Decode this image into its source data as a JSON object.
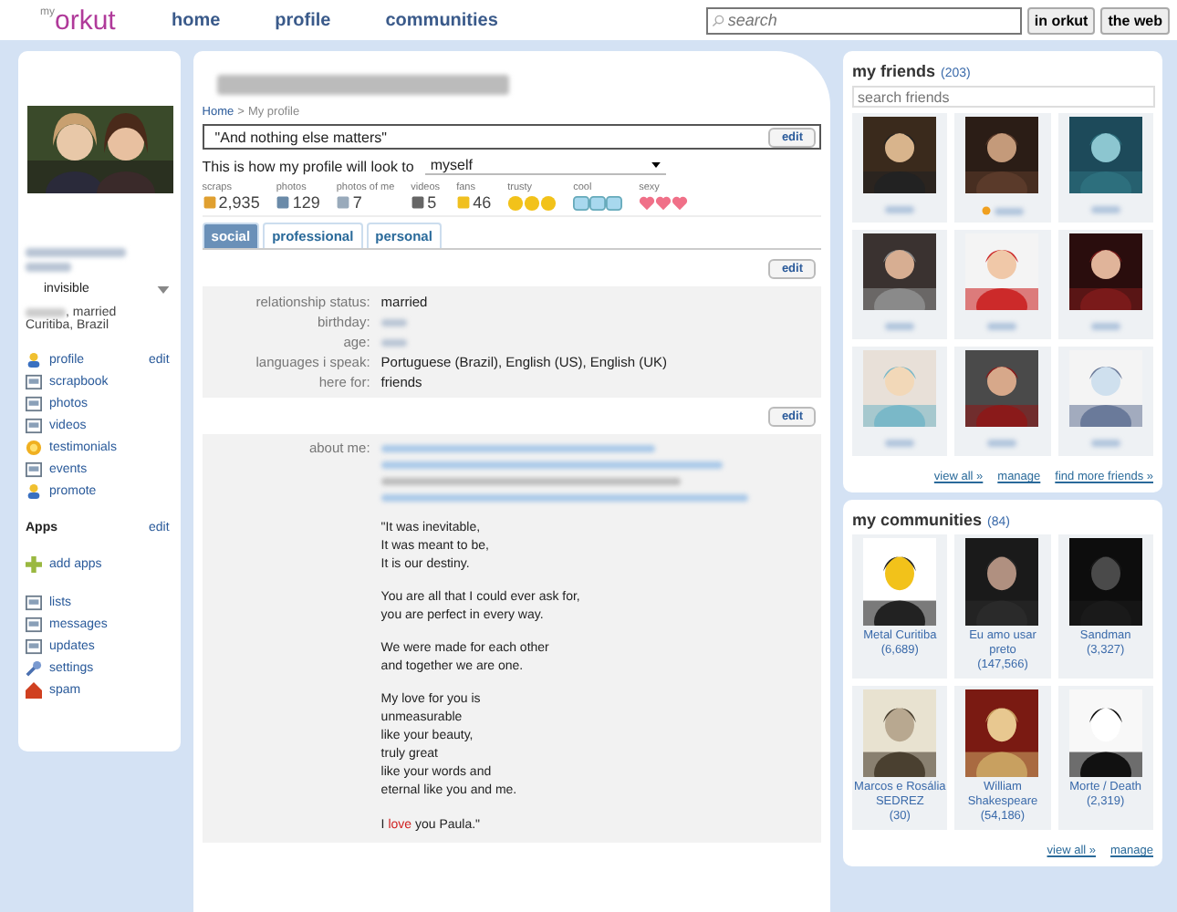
{
  "header": {
    "logo_small": "my",
    "logo": "orkut",
    "nav": [
      {
        "label": "home",
        "selected": false
      },
      {
        "label": "profile",
        "selected": false
      },
      {
        "label": "communities",
        "selected": false
      }
    ],
    "search": {
      "placeholder": "search"
    },
    "search_buttons": [
      "in orkut",
      "the web"
    ]
  },
  "left": {
    "status": "invisible",
    "summary": ", married",
    "location": "Curitiba, Brazil",
    "edit": "edit",
    "menu": [
      {
        "label": "profile"
      },
      {
        "label": "scrapbook"
      },
      {
        "label": "photos"
      },
      {
        "label": "videos"
      },
      {
        "label": "testimonials"
      },
      {
        "label": "events"
      },
      {
        "label": "promote"
      }
    ],
    "apps_heading": "Apps",
    "apps_edit": "edit",
    "apps": [
      {
        "label": "add apps"
      }
    ],
    "tools": [
      {
        "label": "lists"
      },
      {
        "label": "messages"
      },
      {
        "label": "updates"
      },
      {
        "label": "settings"
      },
      {
        "label": "spam"
      }
    ]
  },
  "center": {
    "breadcrumb": {
      "link": "Home",
      "separator": ">",
      "current": "My profile"
    },
    "status_message": "\"And nothing else matters\"",
    "edit_buttons": [
      "edit",
      "edit",
      "edit"
    ],
    "view_as": {
      "label": "This is how my profile will look to",
      "value": "myself"
    },
    "stats": [
      {
        "kind": "count",
        "label": "scraps",
        "value": "2,935"
      },
      {
        "kind": "count",
        "label": "photos",
        "value": "129"
      },
      {
        "kind": "count",
        "label": "photos of me",
        "value": "7"
      },
      {
        "kind": "count",
        "label": "videos",
        "value": "5"
      },
      {
        "kind": "count",
        "label": "fans",
        "value": "46"
      },
      {
        "kind": "rating",
        "label": "trusty",
        "stars": 3
      },
      {
        "kind": "rating",
        "label": "cool",
        "stars": 3
      },
      {
        "kind": "rating",
        "label": "sexy",
        "stars": 3
      }
    ],
    "tabs": [
      {
        "label": "social",
        "selected": true
      },
      {
        "label": "professional",
        "selected": false
      },
      {
        "label": "personal",
        "selected": false
      }
    ],
    "fields": [
      {
        "label": "relationship status:",
        "value": "married",
        "blurred": false
      },
      {
        "label": "birthday:",
        "blurred": true
      },
      {
        "label": "age:",
        "blurred": true
      },
      {
        "label": "languages i speak:",
        "value": "Portuguese (Brazil), English (US), English (UK)",
        "blurred": false
      },
      {
        "label": "here for:",
        "value": "friends",
        "blurred": false
      }
    ],
    "about_label": "about me:",
    "about_links": [
      {
        "kind": "link"
      },
      {
        "kind": "link"
      },
      {
        "kind": "plain"
      },
      {
        "kind": "link"
      }
    ],
    "poem": [
      [
        "\"It was inevitable,",
        "It was meant to be,",
        "It is our destiny."
      ],
      [
        "You are all that I could ever ask for,",
        "you are perfect in every way."
      ],
      [
        "We were made for each other",
        "and together we are one."
      ],
      [
        "My love for you is",
        "unmeasurable",
        "like your beauty,",
        "truly great",
        "like your words and",
        "eternal like you and me."
      ]
    ],
    "closing": [
      {
        "text": "I ",
        "highlight": false
      },
      {
        "text": "love",
        "highlight": true
      },
      {
        "text": " you Paula.\"",
        "highlight": false
      }
    ]
  },
  "friends": {
    "title": "my friends",
    "count": "(203)",
    "search": {
      "placeholder": "search friends"
    },
    "items": [
      {
        "mood": false
      },
      {
        "mood": true
      },
      {
        "mood": false
      },
      {
        "mood": false
      },
      {
        "mood": false
      },
      {
        "mood": false
      },
      {
        "mood": false
      },
      {
        "mood": false
      },
      {
        "mood": false
      }
    ],
    "links": [
      "view all »",
      "manage",
      "find more friends »"
    ]
  },
  "communities": {
    "title": "my communities",
    "count": "(84)",
    "items": [
      {
        "name": "Metal Curitiba",
        "members": "(6,689)"
      },
      {
        "name": "Eu amo usar preto",
        "members": "(147,566)"
      },
      {
        "name": "Sandman",
        "members": "(3,327)"
      },
      {
        "name": "Marcos e Rosália SEDREZ",
        "members": "(30)"
      },
      {
        "name": "William Shakespeare",
        "members": "(54,186)"
      },
      {
        "name": "Morte / Death",
        "members": "(2,319)"
      }
    ],
    "links": [
      "view all »",
      "manage"
    ]
  }
}
